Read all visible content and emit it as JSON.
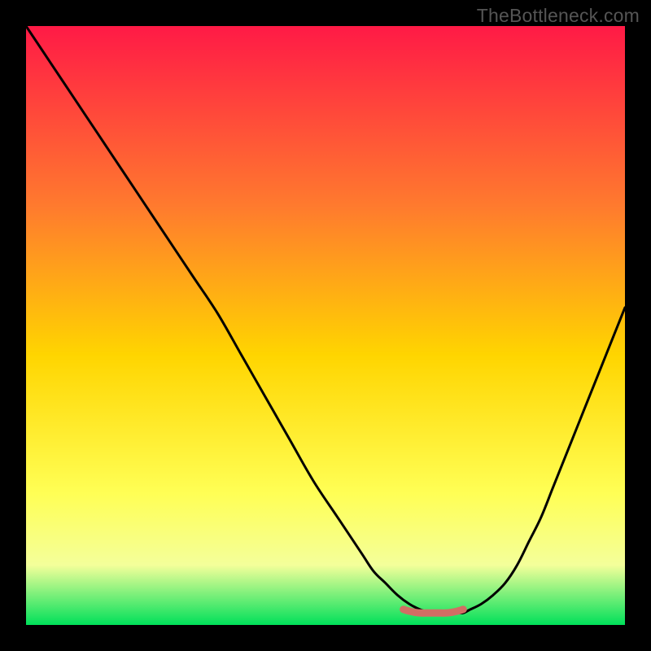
{
  "watermark": "TheBottleneck.com",
  "colors": {
    "gradient_top": "#ff1a46",
    "gradient_mid1": "#ff7a2e",
    "gradient_mid2": "#ffd500",
    "gradient_mid3": "#ffff55",
    "gradient_mid4": "#f4ff9a",
    "gradient_bottom": "#00e05a",
    "curve": "#000000",
    "trough": "#d26e64",
    "frame": "#000000"
  },
  "chart_data": {
    "type": "line",
    "title": "",
    "xlabel": "",
    "ylabel": "",
    "xlim": [
      0,
      100
    ],
    "ylim": [
      0,
      100
    ],
    "series": [
      {
        "name": "bottleneck-curve",
        "x": [
          0,
          4,
          8,
          12,
          16,
          20,
          24,
          28,
          32,
          36,
          40,
          44,
          48,
          52,
          56,
          58,
          60,
          62,
          64,
          66,
          68,
          70,
          72,
          73,
          74,
          76,
          78,
          80,
          82,
          84,
          86,
          88,
          90,
          92,
          94,
          96,
          98,
          100
        ],
        "y": [
          100,
          94,
          88,
          82,
          76,
          70,
          64,
          58,
          52,
          45,
          38,
          31,
          24,
          18,
          12,
          9,
          7,
          5,
          3.5,
          2.5,
          2,
          2,
          2,
          2,
          2.5,
          3.5,
          5,
          7,
          10,
          14,
          18,
          23,
          28,
          33,
          38,
          43,
          48,
          53
        ]
      },
      {
        "name": "trough-marker",
        "x": [
          63,
          64,
          65,
          66,
          67,
          68,
          69,
          70,
          71,
          72,
          73
        ],
        "y": [
          2.6,
          2.3,
          2.1,
          2,
          2,
          2,
          2,
          2,
          2.1,
          2.3,
          2.6
        ]
      }
    ],
    "annotations": []
  }
}
